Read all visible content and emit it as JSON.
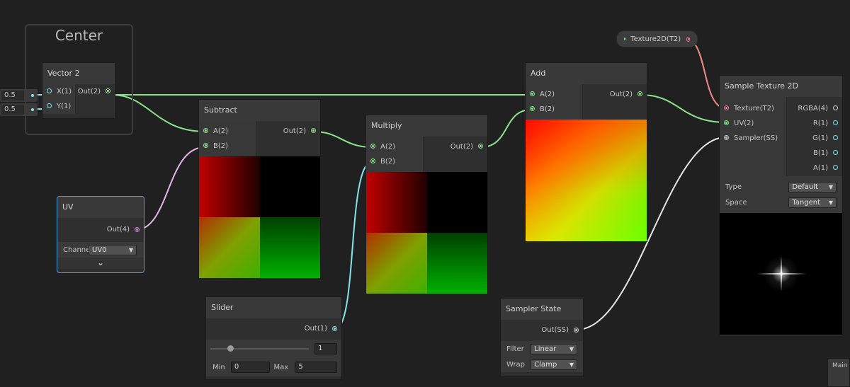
{
  "group": {
    "title": "Center"
  },
  "inline_inputs": [
    {
      "axis": "X",
      "value": "0.5"
    },
    {
      "axis": "Y",
      "value": "0.5"
    }
  ],
  "property": {
    "label": "Texture2D(T2)"
  },
  "nodes": {
    "vector2": {
      "title": "Vector 2",
      "inputs": [
        "X(1)",
        "Y(1)"
      ],
      "output": "Out(2)"
    },
    "subtract": {
      "title": "Subtract",
      "inputs": [
        "A(2)",
        "B(2)"
      ],
      "output": "Out(2)"
    },
    "multiply": {
      "title": "Multiply",
      "inputs": [
        "A(2)",
        "B(2)"
      ],
      "output": "Out(2)"
    },
    "add": {
      "title": "Add",
      "inputs": [
        "A(2)",
        "B(2)"
      ],
      "output": "Out(2)"
    },
    "uv": {
      "title": "UV",
      "output": "Out(4)",
      "channel_label": "Channe",
      "channel_value": "UV0",
      "expand_glyph": "⌄"
    },
    "slider": {
      "title": "Slider",
      "output": "Out(1)",
      "value": "1",
      "level": 0.2,
      "min_label": "Min",
      "min_value": "0",
      "max_label": "Max",
      "max_value": "5"
    },
    "sampler_state": {
      "title": "Sampler State",
      "output": "Out(SS)",
      "filter_label": "Filter",
      "filter_value": "Linear",
      "wrap_label": "Wrap",
      "wrap_value": "Clamp"
    },
    "sample_texture": {
      "title": "Sample Texture 2D",
      "inputs": [
        "Texture(T2)",
        "UV(2)",
        "Sampler(SS)"
      ],
      "outputs": [
        "RGBA(4)",
        "R(1)",
        "G(1)",
        "B(1)",
        "A(1)"
      ],
      "type_label": "Type",
      "type_value": "Default",
      "space_label": "Space",
      "space_value": "Tangent"
    }
  },
  "main_preview": {
    "label": "Main P"
  },
  "colors": {
    "background": "#202020",
    "vector2_wire": "#8be68b",
    "vector4_wire": "#e6b6ea",
    "float_wire": "#84e4e7",
    "texture_wire": "#f08c84",
    "sampler_wire": "#e6e6e6"
  },
  "icons": {
    "dropdown": "▼",
    "expand": "chevron-down-icon",
    "port": "port-dot-icon"
  }
}
